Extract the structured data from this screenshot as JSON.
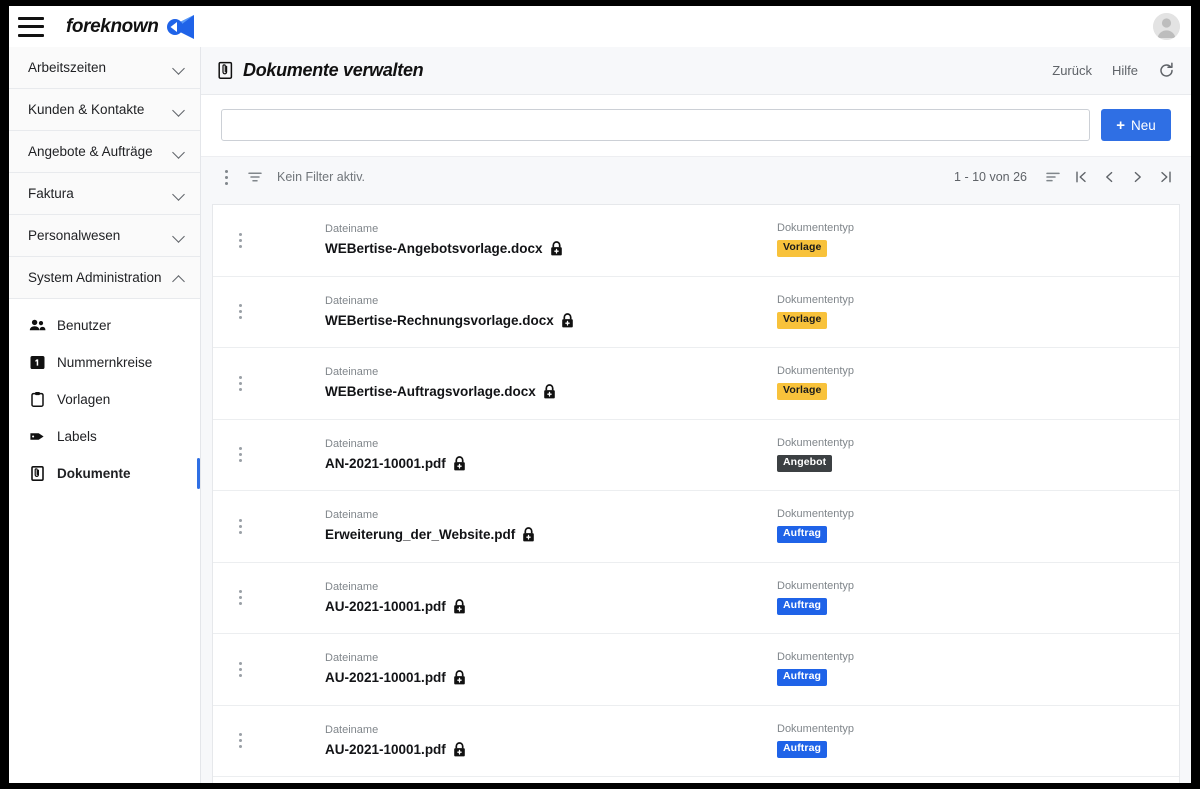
{
  "topbar": {
    "menu_icon": "hamburger-icon",
    "brand_name": "foreknown",
    "brand_mark_icon": "megaphone-logo-icon",
    "avatar_icon": "user-avatar-placeholder"
  },
  "sidebar": {
    "groups": [
      {
        "label": "Arbeitszeiten",
        "expanded": false,
        "chevron": "chevron-down-icon"
      },
      {
        "label": "Kunden & Kontakte",
        "expanded": false,
        "chevron": "chevron-down-icon"
      },
      {
        "label": "Angebote & Aufträge",
        "expanded": false,
        "chevron": "chevron-down-icon"
      },
      {
        "label": "Faktura",
        "expanded": false,
        "chevron": "chevron-down-icon"
      },
      {
        "label": "Personalwesen",
        "expanded": false,
        "chevron": "chevron-down-icon"
      },
      {
        "label": "System Administration",
        "expanded": true,
        "chevron": "chevron-up-icon"
      }
    ],
    "sub_items": [
      {
        "label": "Benutzer",
        "icon": "users-icon",
        "active": false
      },
      {
        "label": "Nummernkreise",
        "icon": "number-box-icon",
        "active": false
      },
      {
        "label": "Vorlagen",
        "icon": "clipboard-icon",
        "active": false
      },
      {
        "label": "Labels",
        "icon": "tag-icon",
        "active": false
      },
      {
        "label": "Dokumente",
        "icon": "document-icon",
        "active": true
      }
    ]
  },
  "page": {
    "title": "Dokumente verwalten",
    "title_icon": "document-icon",
    "back_label": "Zurück",
    "help_label": "Hilfe",
    "refresh_icon": "refresh-icon"
  },
  "search": {
    "value": "",
    "placeholder": "",
    "new_button_label": "Neu",
    "new_button_plus": "+"
  },
  "toolbar": {
    "kebab_icon": "more-vertical-icon",
    "filter_icon": "filter-icon",
    "filter_text": "Kein Filter aktiv.",
    "page_range": "1 - 10 von 26",
    "sort_icon": "sort-icon",
    "first_page_icon": "first-page-icon",
    "prev_page_icon": "previous-page-icon",
    "next_page_icon": "next-page-icon",
    "last_page_icon": "last-page-icon"
  },
  "table": {
    "column_labels": {
      "filename": "Dateiname",
      "doctype": "Dokumententyp"
    },
    "badge_colors": {
      "Vorlage": {
        "bg": "#f8c23b",
        "fg": "#1b1b1b"
      },
      "Angebot": {
        "bg": "#3c4043",
        "fg": "#ffffff"
      },
      "Auftrag": {
        "bg": "#1f63e8",
        "fg": "#ffffff"
      }
    },
    "rows": [
      {
        "filename": "WEBertise-Angebotsvorlage.docx",
        "lock_icon": "lock-icon",
        "doctype": "Vorlage"
      },
      {
        "filename": "WEBertise-Rechnungsvorlage.docx",
        "lock_icon": "lock-icon",
        "doctype": "Vorlage"
      },
      {
        "filename": "WEBertise-Auftragsvorlage.docx",
        "lock_icon": "lock-icon",
        "doctype": "Vorlage"
      },
      {
        "filename": "AN-2021-10001.pdf",
        "lock_icon": "lock-icon",
        "doctype": "Angebot"
      },
      {
        "filename": "Erweiterung_der_Website.pdf",
        "lock_icon": "lock-icon",
        "doctype": "Auftrag"
      },
      {
        "filename": "AU-2021-10001.pdf",
        "lock_icon": "lock-icon",
        "doctype": "Auftrag"
      },
      {
        "filename": "AU-2021-10001.pdf",
        "lock_icon": "lock-icon",
        "doctype": "Auftrag"
      },
      {
        "filename": "AU-2021-10001.pdf",
        "lock_icon": "lock-icon",
        "doctype": "Auftrag"
      }
    ]
  },
  "colors": {
    "accent": "#2f6fe4",
    "page_bg": "#f7f8fa",
    "frame": "#000000"
  }
}
